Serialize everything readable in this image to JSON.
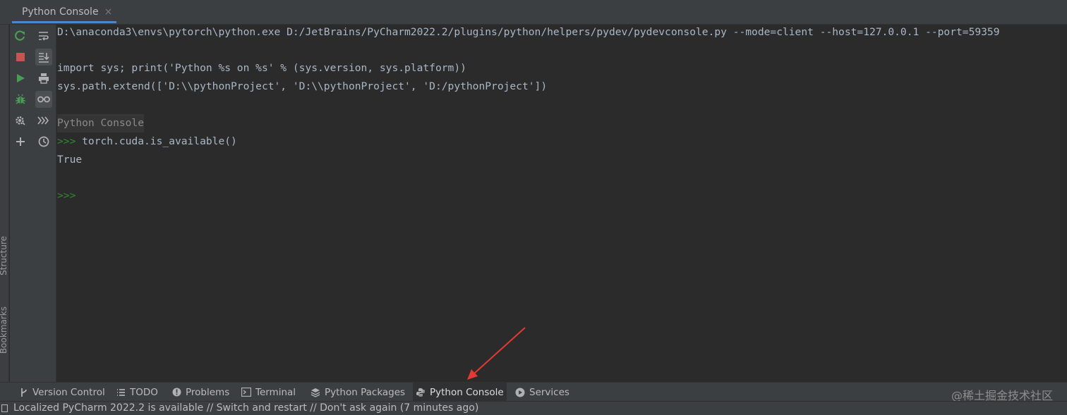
{
  "editor_tab": {
    "title": "Python Console",
    "close": "×"
  },
  "side_labels": {
    "structure": "Structure",
    "bookmarks": "Bookmarks"
  },
  "console": {
    "command_line": "D:\\anaconda3\\envs\\pytorch\\python.exe D:/JetBrains/PyCharm2022.2/plugins/python/helpers/pydev/pydevconsole.py --mode=client --host=127.0.0.1 --port=59359",
    "import_line": "import sys; print('Python %s on %s' % (sys.version, sys.platform))",
    "path_line": "sys.path.extend(['D:\\\\pythonProject', 'D:\\\\pythonProject', 'D:/pythonProject'])",
    "banner": "Python Console",
    "prompt": ">>>",
    "input": " torch.cuda.is_available()",
    "output": "True",
    "empty_prompt": ">>>"
  },
  "bottom_tabs": [
    {
      "label": "Version Control",
      "icon": "branch-icon"
    },
    {
      "label": "TODO",
      "icon": "list-icon"
    },
    {
      "label": "Problems",
      "icon": "info-icon"
    },
    {
      "label": "Terminal",
      "icon": "terminal-icon"
    },
    {
      "label": "Python Packages",
      "icon": "layers-icon"
    },
    {
      "label": "Python Console",
      "icon": "python-icon",
      "selected": true
    },
    {
      "label": "Services",
      "icon": "play-circle-icon"
    }
  ],
  "watermark": "@稀土掘金技术社区",
  "status_bar": {
    "text": "Localized PyCharm 2022.2 is available // Switch and restart // Don't ask again (7 minutes ago)"
  },
  "colors": {
    "accent": "#4a88c7",
    "prompt_green": "#2e8b2e",
    "stop_red": "#c75450",
    "run_green": "#499c54",
    "annotation_arrow": "#e53935"
  }
}
